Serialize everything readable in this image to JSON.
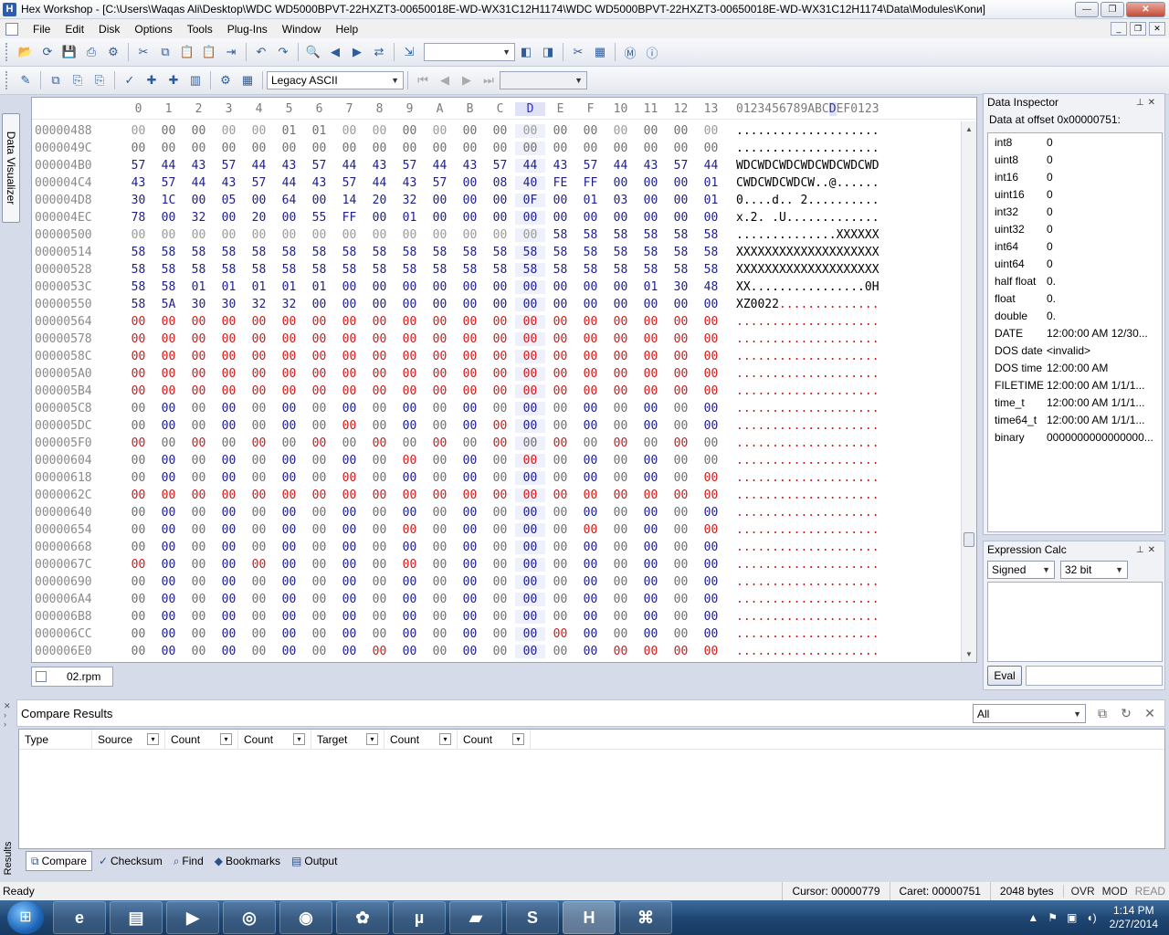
{
  "window": {
    "title": "Hex Workshop - [C:\\Users\\Waqas Ali\\Desktop\\WDC WD5000BPVT-22HXZT3-00650018E-WD-WX31C12H1174\\WDC WD5000BPVT-22HXZT3-00650018E-WD-WX31C12H1174\\Data\\Modules\\Konи]",
    "app_icon_letter": "H"
  },
  "menu": [
    "File",
    "Edit",
    "Disk",
    "Options",
    "Tools",
    "Plug-Ins",
    "Window",
    "Help"
  ],
  "toolbar": {
    "encoding_select": "Legacy ASCII",
    "icons1": [
      "open-icon",
      "reload-icon",
      "save-icon",
      "print-icon",
      "settings-icon",
      "cut-icon",
      "copy-icon",
      "paste-icon",
      "paste-special-icon",
      "export-icon",
      "undo-icon",
      "redo-icon",
      "find-icon",
      "find-prev-icon",
      "find-next-icon",
      "replace-icon",
      "goto-icon"
    ],
    "icons2": [
      "properties-icon",
      "compare-icon",
      "copy-hex-icon",
      "copy-text-icon",
      "data-visualizer-icon",
      "operations-icon",
      "checksum-icon",
      "chart-icon",
      "gear-icon",
      "calculator-icon"
    ]
  },
  "side_tab": "Data Visualizer",
  "hex": {
    "column_headers": [
      "0",
      "1",
      "2",
      "3",
      "4",
      "5",
      "6",
      "7",
      "8",
      "9",
      "A",
      "B",
      "C",
      "D",
      "E",
      "F",
      "10",
      "11",
      "12",
      "13"
    ],
    "ascii_header_pre": "0123456789ABC",
    "ascii_header_sel": "D",
    "ascii_header_post": "EF0123",
    "rows": [
      {
        "addr": "00000488",
        "bytes": [
          "00",
          "00",
          "00",
          "00",
          "00",
          "01",
          "01",
          "00",
          "00",
          "00",
          "00",
          "00",
          "00",
          "00",
          "00",
          "00",
          "00",
          "00",
          "00",
          "00"
        ],
        "ascii": "...................."
      },
      {
        "addr": "0000049C",
        "bytes": [
          "00",
          "00",
          "00",
          "00",
          "00",
          "00",
          "00",
          "00",
          "00",
          "00",
          "00",
          "00",
          "00",
          "00",
          "00",
          "00",
          "00",
          "00",
          "00",
          "00"
        ],
        "ascii": "...................."
      },
      {
        "addr": "000004B0",
        "bytes": [
          "57",
          "44",
          "43",
          "57",
          "44",
          "43",
          "57",
          "44",
          "43",
          "57",
          "44",
          "43",
          "57",
          "44",
          "43",
          "57",
          "44",
          "43",
          "57",
          "44"
        ],
        "ascii": "WDCWDCWDCWDCWDCWDCWD"
      },
      {
        "addr": "000004C4",
        "bytes": [
          "43",
          "57",
          "44",
          "43",
          "57",
          "44",
          "43",
          "57",
          "44",
          "43",
          "57",
          "00",
          "08",
          "40",
          "FE",
          "FF",
          "00",
          "00",
          "00",
          "01"
        ],
        "ascii": "CWDCWDCWDCW..@......"
      },
      {
        "addr": "000004D8",
        "bytes": [
          "30",
          "1C",
          "00",
          "05",
          "00",
          "64",
          "00",
          "14",
          "20",
          "32",
          "00",
          "00",
          "00",
          "0F",
          "00",
          "01",
          "03",
          "00",
          "00",
          "01"
        ],
        "ascii": "0....d.. 2.........."
      },
      {
        "addr": "000004EC",
        "bytes": [
          "78",
          "00",
          "32",
          "00",
          "20",
          "00",
          "55",
          "FF",
          "00",
          "01",
          "00",
          "00",
          "00",
          "00",
          "00",
          "00",
          "00",
          "00",
          "00",
          "00"
        ],
        "ascii": "x.2. .U............."
      },
      {
        "addr": "00000500",
        "bytes": [
          "00",
          "00",
          "00",
          "00",
          "00",
          "00",
          "00",
          "00",
          "00",
          "00",
          "00",
          "00",
          "00",
          "00",
          "58",
          "58",
          "58",
          "58",
          "58",
          "58"
        ],
        "ascii": "..............XXXXXX"
      },
      {
        "addr": "00000514",
        "bytes": [
          "58",
          "58",
          "58",
          "58",
          "58",
          "58",
          "58",
          "58",
          "58",
          "58",
          "58",
          "58",
          "58",
          "58",
          "58",
          "58",
          "58",
          "58",
          "58",
          "58"
        ],
        "ascii": "XXXXXXXXXXXXXXXXXXXX"
      },
      {
        "addr": "00000528",
        "bytes": [
          "58",
          "58",
          "58",
          "58",
          "58",
          "58",
          "58",
          "58",
          "58",
          "58",
          "58",
          "58",
          "58",
          "58",
          "58",
          "58",
          "58",
          "58",
          "58",
          "58"
        ],
        "ascii": "XXXXXXXXXXXXXXXXXXXX"
      },
      {
        "addr": "0000053C",
        "bytes": [
          "58",
          "58",
          "01",
          "01",
          "01",
          "01",
          "01",
          "00",
          "00",
          "00",
          "00",
          "00",
          "00",
          "00",
          "00",
          "00",
          "00",
          "01",
          "30",
          "48"
        ],
        "ascii": "XX................0H"
      },
      {
        "addr": "00000550",
        "bytes": [
          "58",
          "5A",
          "30",
          "30",
          "32",
          "32",
          "00",
          "00",
          "00",
          "00",
          "00",
          "00",
          "00",
          "00",
          "00",
          "00",
          "00",
          "00",
          "00",
          "00"
        ],
        "ascii": "XZ0022.............."
      },
      {
        "addr": "00000564",
        "bytes": [
          "00",
          "00",
          "00",
          "00",
          "00",
          "00",
          "00",
          "00",
          "00",
          "00",
          "00",
          "00",
          "00",
          "00",
          "00",
          "00",
          "00",
          "00",
          "00",
          "00"
        ],
        "ascii": "...................."
      },
      {
        "addr": "00000578",
        "bytes": [
          "00",
          "00",
          "00",
          "00",
          "00",
          "00",
          "00",
          "00",
          "00",
          "00",
          "00",
          "00",
          "00",
          "00",
          "00",
          "00",
          "00",
          "00",
          "00",
          "00"
        ],
        "ascii": "...................."
      },
      {
        "addr": "0000058C",
        "bytes": [
          "00",
          "00",
          "00",
          "00",
          "00",
          "00",
          "00",
          "00",
          "00",
          "00",
          "00",
          "00",
          "00",
          "00",
          "00",
          "00",
          "00",
          "00",
          "00",
          "00"
        ],
        "ascii": "...................."
      },
      {
        "addr": "000005A0",
        "bytes": [
          "00",
          "00",
          "00",
          "00",
          "00",
          "00",
          "00",
          "00",
          "00",
          "00",
          "00",
          "00",
          "00",
          "00",
          "00",
          "00",
          "00",
          "00",
          "00",
          "00"
        ],
        "ascii": "...................."
      },
      {
        "addr": "000005B4",
        "bytes": [
          "00",
          "00",
          "00",
          "00",
          "00",
          "00",
          "00",
          "00",
          "00",
          "00",
          "00",
          "00",
          "00",
          "00",
          "00",
          "00",
          "00",
          "00",
          "00",
          "00"
        ],
        "ascii": "...................."
      },
      {
        "addr": "000005C8",
        "bytes": [
          "00",
          "00",
          "00",
          "00",
          "00",
          "00",
          "00",
          "00",
          "00",
          "00",
          "00",
          "00",
          "00",
          "00",
          "00",
          "00",
          "00",
          "00",
          "00",
          "00"
        ],
        "ascii": "...................."
      },
      {
        "addr": "000005DC",
        "bytes": [
          "00",
          "00",
          "00",
          "00",
          "00",
          "00",
          "00",
          "00",
          "00",
          "00",
          "00",
          "00",
          "00",
          "00",
          "00",
          "00",
          "00",
          "00",
          "00",
          "00"
        ],
        "ascii": "...................."
      },
      {
        "addr": "000005F0",
        "bytes": [
          "00",
          "00",
          "00",
          "00",
          "00",
          "00",
          "00",
          "00",
          "00",
          "00",
          "00",
          "00",
          "00",
          "00",
          "00",
          "00",
          "00",
          "00",
          "00",
          "00"
        ],
        "ascii": "...................."
      },
      {
        "addr": "00000604",
        "bytes": [
          "00",
          "00",
          "00",
          "00",
          "00",
          "00",
          "00",
          "00",
          "00",
          "00",
          "00",
          "00",
          "00",
          "00",
          "00",
          "00",
          "00",
          "00",
          "00",
          "00"
        ],
        "ascii": "...................."
      },
      {
        "addr": "00000618",
        "bytes": [
          "00",
          "00",
          "00",
          "00",
          "00",
          "00",
          "00",
          "00",
          "00",
          "00",
          "00",
          "00",
          "00",
          "00",
          "00",
          "00",
          "00",
          "00",
          "00",
          "00"
        ],
        "ascii": "...................."
      },
      {
        "addr": "0000062C",
        "bytes": [
          "00",
          "00",
          "00",
          "00",
          "00",
          "00",
          "00",
          "00",
          "00",
          "00",
          "00",
          "00",
          "00",
          "00",
          "00",
          "00",
          "00",
          "00",
          "00",
          "00"
        ],
        "ascii": "...................."
      },
      {
        "addr": "00000640",
        "bytes": [
          "00",
          "00",
          "00",
          "00",
          "00",
          "00",
          "00",
          "00",
          "00",
          "00",
          "00",
          "00",
          "00",
          "00",
          "00",
          "00",
          "00",
          "00",
          "00",
          "00"
        ],
        "ascii": "...................."
      },
      {
        "addr": "00000654",
        "bytes": [
          "00",
          "00",
          "00",
          "00",
          "00",
          "00",
          "00",
          "00",
          "00",
          "00",
          "00",
          "00",
          "00",
          "00",
          "00",
          "00",
          "00",
          "00",
          "00",
          "00"
        ],
        "ascii": "...................."
      },
      {
        "addr": "00000668",
        "bytes": [
          "00",
          "00",
          "00",
          "00",
          "00",
          "00",
          "00",
          "00",
          "00",
          "00",
          "00",
          "00",
          "00",
          "00",
          "00",
          "00",
          "00",
          "00",
          "00",
          "00"
        ],
        "ascii": "...................."
      },
      {
        "addr": "0000067C",
        "bytes": [
          "00",
          "00",
          "00",
          "00",
          "00",
          "00",
          "00",
          "00",
          "00",
          "00",
          "00",
          "00",
          "00",
          "00",
          "00",
          "00",
          "00",
          "00",
          "00",
          "00"
        ],
        "ascii": "...................."
      },
      {
        "addr": "00000690",
        "bytes": [
          "00",
          "00",
          "00",
          "00",
          "00",
          "00",
          "00",
          "00",
          "00",
          "00",
          "00",
          "00",
          "00",
          "00",
          "00",
          "00",
          "00",
          "00",
          "00",
          "00"
        ],
        "ascii": "...................."
      },
      {
        "addr": "000006A4",
        "bytes": [
          "00",
          "00",
          "00",
          "00",
          "00",
          "00",
          "00",
          "00",
          "00",
          "00",
          "00",
          "00",
          "00",
          "00",
          "00",
          "00",
          "00",
          "00",
          "00",
          "00"
        ],
        "ascii": "...................."
      },
      {
        "addr": "000006B8",
        "bytes": [
          "00",
          "00",
          "00",
          "00",
          "00",
          "00",
          "00",
          "00",
          "00",
          "00",
          "00",
          "00",
          "00",
          "00",
          "00",
          "00",
          "00",
          "00",
          "00",
          "00"
        ],
        "ascii": "...................."
      },
      {
        "addr": "000006CC",
        "bytes": [
          "00",
          "00",
          "00",
          "00",
          "00",
          "00",
          "00",
          "00",
          "00",
          "00",
          "00",
          "00",
          "00",
          "00",
          "00",
          "00",
          "00",
          "00",
          "00",
          "00"
        ],
        "ascii": "...................."
      },
      {
        "addr": "000006E0",
        "bytes": [
          "00",
          "00",
          "00",
          "00",
          "00",
          "00",
          "00",
          "00",
          "00",
          "00",
          "00",
          "00",
          "00",
          "00",
          "00",
          "00",
          "00",
          "00",
          "00",
          "00"
        ],
        "ascii": "...................."
      }
    ],
    "color_codes": [
      "03300330030330330330",
      "33333333333333333333",
      "11111111111111111111",
      "11111111111111111111",
      "11111111111111111111",
      "11111111111111111111",
      "00000000000000111111",
      "11111111111111111111",
      "11111111111111111111",
      "11111111111111111111",
      "11111111111111111111",
      "22222222222222222222",
      "22222222222222222222",
      "22222222222222222222",
      "22222222222222222222",
      "22222222222222222222",
      "31313131313131313131",
      "31313132313121313131",
      "23232323232323232323",
      "31313131323132313133",
      "31313132313131313132",
      "22222222222222222222",
      "31313131313131313131",
      "31313131323131323132",
      "31313131313131313131",
      "21312131323131313131",
      "31313131313131313131",
      "31313131313131313131",
      "31313131313131313131",
      "31313131313131213131",
      "31313131213131312222"
    ],
    "red_ascii_from": [
      20,
      20,
      20,
      20,
      20,
      20,
      20,
      20,
      20,
      20,
      6,
      0,
      0,
      0,
      0,
      0,
      0,
      0,
      0,
      0,
      0,
      0,
      0,
      0,
      0,
      0,
      0,
      0,
      0,
      0,
      0
    ],
    "file_tab": "02.rpm"
  },
  "data_inspector": {
    "title": "Data Inspector",
    "offset_label": "Data at offset 0x00000751:",
    "rows": [
      {
        "k": "int8",
        "v": "0"
      },
      {
        "k": "uint8",
        "v": "0"
      },
      {
        "k": "int16",
        "v": "0"
      },
      {
        "k": "uint16",
        "v": "0"
      },
      {
        "k": "int32",
        "v": "0"
      },
      {
        "k": "uint32",
        "v": "0"
      },
      {
        "k": "int64",
        "v": "0"
      },
      {
        "k": "uint64",
        "v": "0"
      },
      {
        "k": "half float",
        "v": "0."
      },
      {
        "k": "float",
        "v": "0."
      },
      {
        "k": "double",
        "v": "0."
      },
      {
        "k": "DATE",
        "v": "12:00:00 AM 12/30..."
      },
      {
        "k": "DOS date",
        "v": "<invalid>"
      },
      {
        "k": "DOS time",
        "v": "12:00:00 AM"
      },
      {
        "k": "FILETIME",
        "v": "12:00:00 AM 1/1/1..."
      },
      {
        "k": "time_t",
        "v": "12:00:00 AM 1/1/1..."
      },
      {
        "k": "time64_t",
        "v": "12:00:00 AM 1/1/1..."
      },
      {
        "k": "binary",
        "v": "0000000000000000..."
      }
    ]
  },
  "expression_calc": {
    "title": "Expression Calc",
    "sign": "Signed",
    "bits": "32 bit",
    "eval_button": "Eval"
  },
  "results": {
    "side_label": "Results",
    "title": "Compare Results",
    "filter": "All",
    "columns": [
      "Type",
      "Source",
      "Count",
      "Count",
      "Target",
      "Count",
      "Count"
    ],
    "tabs": [
      {
        "label": "Compare",
        "icon": "compare-icon"
      },
      {
        "label": "Checksum",
        "icon": "checksum-icon"
      },
      {
        "label": "Find",
        "icon": "find-icon"
      },
      {
        "label": "Bookmarks",
        "icon": "bookmarks-icon"
      },
      {
        "label": "Output",
        "icon": "output-icon"
      }
    ]
  },
  "status": {
    "ready": "Ready",
    "cursor": "Cursor: 00000779",
    "caret": "Caret: 00000751",
    "size": "2048 bytes",
    "ovr": "OVR",
    "mod": "MOD",
    "read": "READ"
  },
  "taskbar": {
    "apps": [
      "ie-icon",
      "explorer-icon",
      "media-player-icon",
      "chrome-icon",
      "firefox-icon",
      "icq-icon",
      "utorrent-icon",
      "book-icon",
      "skype-icon",
      "hex-workshop-icon",
      "network-icon"
    ],
    "time": "1:14 PM",
    "date": "2/27/2014"
  }
}
